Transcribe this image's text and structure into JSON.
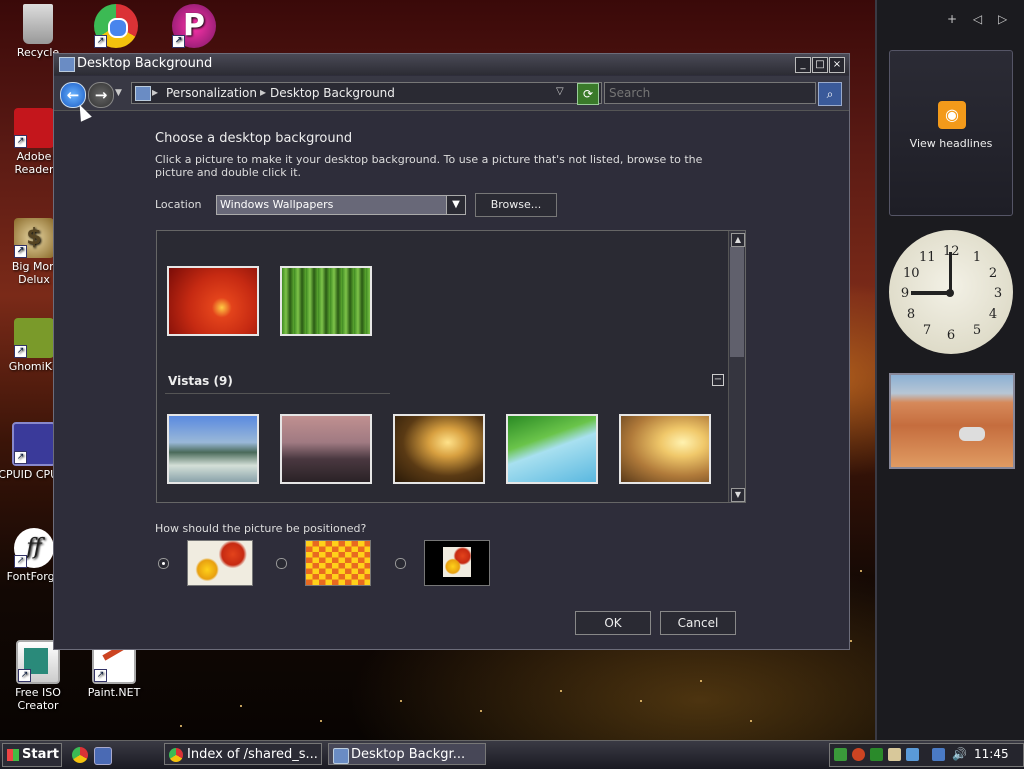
{
  "desktop": {
    "icons": [
      {
        "label": "Recycle"
      },
      {
        "label": ""
      },
      {
        "label": ""
      },
      {
        "label": "Adobe Reader"
      },
      {
        "label": "Big Mon Delux"
      },
      {
        "label": "GhomiKit"
      },
      {
        "label": "CPUID CPU-Z"
      },
      {
        "label": "FontForge"
      },
      {
        "label": "Free ISO Creator"
      },
      {
        "label": "Paint.NET"
      }
    ]
  },
  "sidebar": {
    "controls": [
      "+",
      "◁",
      "▷"
    ],
    "feed_label": "View headlines",
    "feed_icon": "rss-icon",
    "clock_numbers": [
      "12",
      "1",
      "2",
      "3",
      "4",
      "5",
      "6",
      "7",
      "8",
      "9",
      "10",
      "11"
    ]
  },
  "window": {
    "title": "Desktop Background",
    "title_buttons": [
      "_",
      "□",
      "×"
    ],
    "address": {
      "breadcrumb_1": "Personalization",
      "breadcrumb_2": "Desktop Background",
      "separator": "▸",
      "search_placeholder": "Search"
    },
    "heading": "Choose a desktop background",
    "description": "Click a picture to make it your desktop background. To use a picture that's not listed, browse to the picture and double click it.",
    "location_label": "Location",
    "location_value": "Windows Wallpapers",
    "browse_label": "Browse...",
    "gallery": {
      "group_label": "Vistas (9)",
      "row1": [
        {
          "name": "red-flower",
          "colors": [
            "#e3431b",
            "#a61510"
          ]
        },
        {
          "name": "bamboo",
          "colors": [
            "#4d9d2e",
            "#1a4d12"
          ]
        }
      ],
      "row2": [
        {
          "name": "lake-mountains",
          "colors": [
            "#3a6ec4",
            "#c7d7c9"
          ]
        },
        {
          "name": "dusk-hills",
          "colors": [
            "#b07a7a",
            "#3a2a2e"
          ]
        },
        {
          "name": "golden-rocks",
          "colors": [
            "#e7b24a",
            "#3d2b14"
          ]
        },
        {
          "name": "palm-leaf",
          "colors": [
            "#6ec4e4",
            "#3f9a2c"
          ]
        },
        {
          "name": "sunset-grass",
          "colors": [
            "#f3d27a",
            "#8a5a2a"
          ]
        }
      ]
    },
    "position_question": "How should the picture be positioned?",
    "position_options": [
      "fit-to-screen",
      "tile",
      "center"
    ],
    "ok_label": "OK",
    "cancel_label": "Cancel"
  },
  "taskbar": {
    "start_label": "Start",
    "tasks": [
      {
        "label": "Index of /shared_s...",
        "active": false
      },
      {
        "label": "Desktop Backgr...",
        "active": true
      }
    ],
    "clock": "11:45"
  }
}
